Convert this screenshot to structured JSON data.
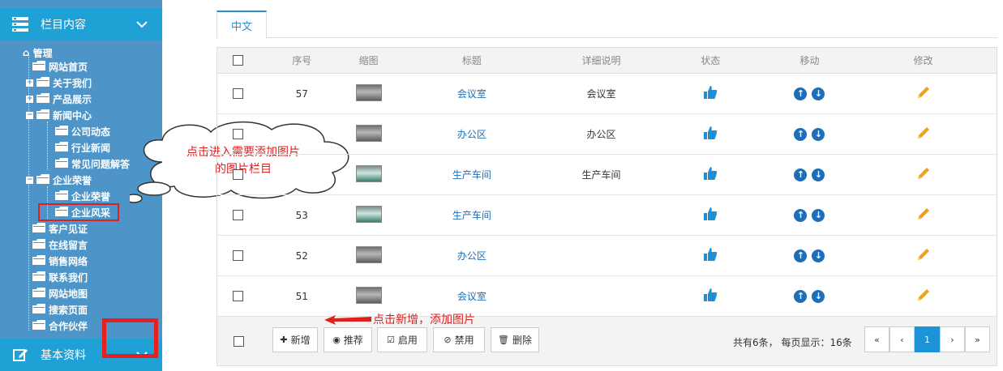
{
  "sidebar": {
    "section1_title": "栏目内容",
    "section2_title": "基本资料",
    "tree": {
      "root": "管理",
      "items": [
        {
          "label": "网站首页"
        },
        {
          "label": "关于我们"
        },
        {
          "label": "产品展示"
        },
        {
          "label": "新闻中心"
        },
        {
          "label": "公司动态"
        },
        {
          "label": "行业新闻"
        },
        {
          "label": "常见问题解答"
        },
        {
          "label": "企业荣誉"
        },
        {
          "label": "企业荣誉"
        },
        {
          "label": "企业风采"
        },
        {
          "label": "客户见证"
        },
        {
          "label": "在线留言"
        },
        {
          "label": "销售网络"
        },
        {
          "label": "联系我们"
        },
        {
          "label": "网站地图"
        },
        {
          "label": "搜索页面"
        },
        {
          "label": "合作伙伴"
        }
      ]
    }
  },
  "tabs": [
    {
      "label": "中文"
    }
  ],
  "table": {
    "headers": [
      "序号",
      "缩图",
      "标题",
      "详细说明",
      "状态",
      "移动",
      "修改"
    ],
    "rows": [
      {
        "seq": "57",
        "title": "会议室",
        "desc": "会议室"
      },
      {
        "seq": "",
        "title": "办公区",
        "desc": "办公区"
      },
      {
        "seq": "",
        "title": "生产车间",
        "desc": "生产车间"
      },
      {
        "seq": "53",
        "title": "生产车间",
        "desc": ""
      },
      {
        "seq": "52",
        "title": "办公区",
        "desc": ""
      },
      {
        "seq": "51",
        "title": "会议室",
        "desc": ""
      }
    ]
  },
  "toolbar": {
    "add": "新增",
    "recommend": "推荐",
    "enable": "启用",
    "disable": "禁用",
    "delete": "删除"
  },
  "pagination": {
    "summary": "共有6条， 每页显示：16条",
    "first": "«",
    "prev": "‹",
    "current": "1",
    "next": "›",
    "last": "»"
  },
  "annotations": {
    "cloud": "点击进入需要添加图片的图片栏目",
    "add_hint": "点击新增，添加图片"
  },
  "colors": {
    "sidebar_bg": "#4d95c8",
    "section_header": "#1fa1d6",
    "accent_blue": "#1c94d6",
    "annotation_red": "#e0201e",
    "edit_orange": "#f0a020"
  }
}
